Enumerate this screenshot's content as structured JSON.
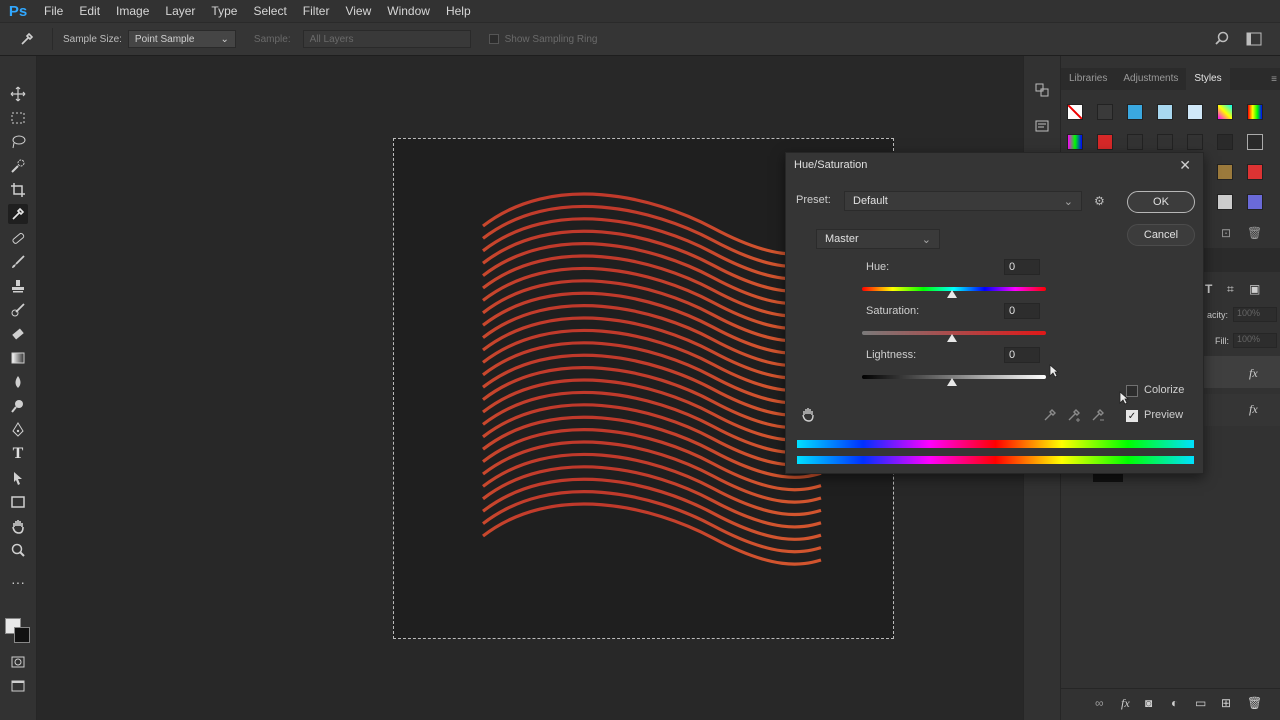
{
  "app": {
    "logo": "Ps"
  },
  "menu": [
    "File",
    "Edit",
    "Image",
    "Layer",
    "Type",
    "Select",
    "Filter",
    "View",
    "Window",
    "Help"
  ],
  "options": {
    "sample_size_label": "Sample Size:",
    "sample_size_value": "Point Sample",
    "sample_label": "Sample:",
    "sample_value": "All Layers",
    "show_ring_label": "Show Sampling Ring"
  },
  "panel": {
    "tabs": [
      "Libraries",
      "Adjustments",
      "Styles"
    ],
    "opacity_label": "acity:",
    "opacity_value": "100%",
    "fill_label": "Fill:",
    "fill_value": "100%"
  },
  "dialog": {
    "title": "Hue/Saturation",
    "preset_label": "Preset:",
    "preset_value": "Default",
    "ok_label": "OK",
    "cancel_label": "Cancel",
    "channel_value": "Master",
    "hue_label": "Hue:",
    "hue_value": "0",
    "saturation_label": "Saturation:",
    "saturation_value": "0",
    "lightness_label": "Lightness:",
    "lightness_value": "0",
    "colorize_label": "Colorize",
    "colorize_checked": false,
    "preview_label": "Preview",
    "preview_checked": true
  },
  "colors": {
    "accent": "#31a8ff",
    "stroke_top": "#c0392b",
    "stroke_bottom": "#d2552e"
  }
}
